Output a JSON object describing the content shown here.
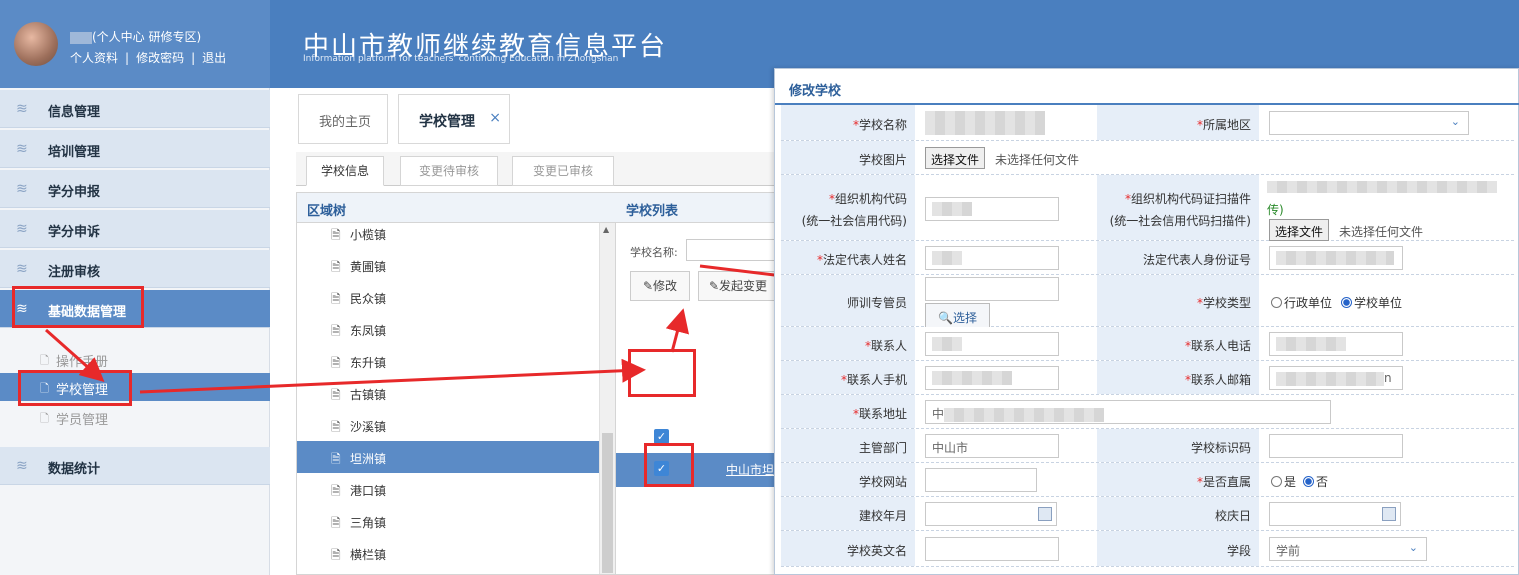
{
  "header": {
    "user_center": "(个人中心 研修专区)",
    "link_profile": "个人资料",
    "link_password": "修改密码",
    "link_logout": "退出",
    "sep": "|",
    "site_title": "中山市教师继续教育信息平台",
    "site_subtitle": "Information platform for teachers' continuing Education in Zhongshan"
  },
  "sidebar": {
    "items": [
      {
        "label": "信息管理"
      },
      {
        "label": "培训管理"
      },
      {
        "label": "学分申报"
      },
      {
        "label": "学分申诉"
      },
      {
        "label": "注册审核"
      },
      {
        "label": "基础数据管理"
      },
      {
        "label": "数据统计"
      }
    ],
    "sub_items": [
      {
        "label": "操作手册"
      },
      {
        "label": "学校管理"
      },
      {
        "label": "学员管理"
      }
    ]
  },
  "tabs": {
    "home": "我的主页",
    "school_mgmt": "学校管理",
    "close": "×"
  },
  "subtabs": [
    "学校信息",
    "变更待审核",
    "变更已审核"
  ],
  "tree": {
    "title": "区域树",
    "nodes": [
      "小榄镇",
      "黄圃镇",
      "民众镇",
      "东凤镇",
      "东升镇",
      "古镇镇",
      "沙溪镇",
      "坦洲镇",
      "港口镇",
      "三角镇",
      "横栏镇"
    ]
  },
  "list": {
    "title": "学校列表",
    "search_label": "学校名称:",
    "edit_btn": "修改",
    "change_btn": "发起变更",
    "row_link": "中山市坦"
  },
  "dialog": {
    "title": "修改学校",
    "school_name_label": "学校名称",
    "region_label": "所属地区",
    "school_image_label": "学校图片",
    "file_btn": "选择文件",
    "file_none": "未选择任何文件",
    "org_code_label": "组织机构代码",
    "org_code_label2": "(统一社会信用代码)",
    "org_scan_label": "组织机构代码证扫描件",
    "org_scan_label2": "(统一社会信用代码扫描件)",
    "org_scan_hint": "传)",
    "legal_name_label": "法定代表人姓名",
    "legal_id_label": "法定代表人身份证号",
    "trainer_label": "师训专管员",
    "select_btn": "选择",
    "school_type_label": "学校类型",
    "type_admin": "行政单位",
    "type_school": "学校单位",
    "contact_label": "联系人",
    "contact_phone_label": "联系人电话",
    "contact_mobile_label": "联系人手机",
    "contact_email_label": "联系人邮箱",
    "email_suffix": "n",
    "address_label": "联系地址",
    "address_prefix": "中",
    "dept_label": "主管部门",
    "dept_value": "中山市",
    "school_id_label": "学校标识码",
    "website_label": "学校网站",
    "direct_label": "是否直属",
    "yes": "是",
    "no": "否",
    "founded_label": "建校年月",
    "anniversary_label": "校庆日",
    "english_name_label": "学校英文名",
    "stage_label": "学段",
    "stage_value": "学前",
    "req": "*"
  },
  "colors": {
    "brand": "#4a7fbf",
    "highlight": "#e7292a",
    "active": "#5b8bc6"
  }
}
